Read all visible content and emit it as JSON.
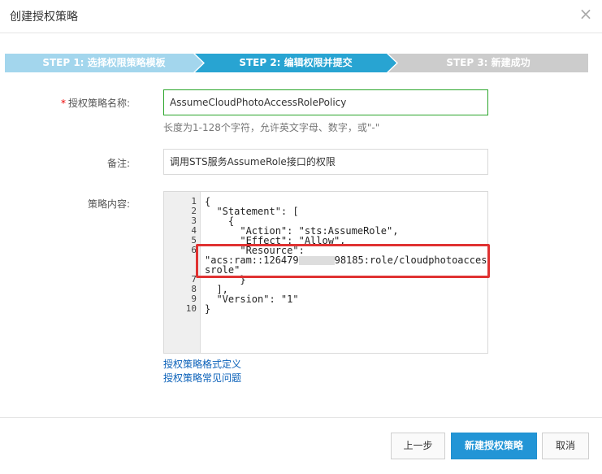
{
  "dialog": {
    "title": "创建授权策略",
    "close_glyph": "×"
  },
  "steps": [
    {
      "label": "STEP 1:  选择权限策略模板",
      "state": "done"
    },
    {
      "label": "STEP 2:  编辑权限并提交",
      "state": "active"
    },
    {
      "label": "STEP 3:  新建成功",
      "state": "pending"
    }
  ],
  "form": {
    "name_required_mark": "*",
    "name_label": "授权策略名称:",
    "name_value": "AssumeCloudPhotoAccessRolePolicy",
    "name_hint": "长度为1-128个字符，允许英文字母、数字，或\"-\"",
    "remark_label": "备注:",
    "remark_value": "调用STS服务AssumeRole接口的权限",
    "policy_label": "策略内容:"
  },
  "editor": {
    "line_numbers": [
      "1",
      "2",
      "3",
      "4",
      "5",
      "6",
      "7",
      "8",
      "9",
      "10"
    ],
    "lines": [
      "{",
      "  \"Statement\": [",
      "    {",
      "      \"Action\": \"sts:AssumeRole\",",
      "      \"Effect\": \"Allow\",",
      "      \"Resource\":",
      "      }",
      "  ],",
      "  \"Version\": \"1\"",
      "}"
    ],
    "resource_part1": "\"acs:ram::126479",
    "resource_part2": "98185:role/cloudphotoacces",
    "resource_part3": "srole\""
  },
  "links": {
    "format": "授权策略格式定义",
    "faq": "授权策略常见问题"
  },
  "buttons": {
    "prev": "上一步",
    "create": "新建授权策略",
    "cancel": "取消"
  },
  "colors": {
    "step_done": "#a3d6ed",
    "step_active": "#28a4d2",
    "step_pending": "#cccccc",
    "primary_button": "#2295d6",
    "highlight_border": "#e03232",
    "link": "#0b61b9"
  }
}
